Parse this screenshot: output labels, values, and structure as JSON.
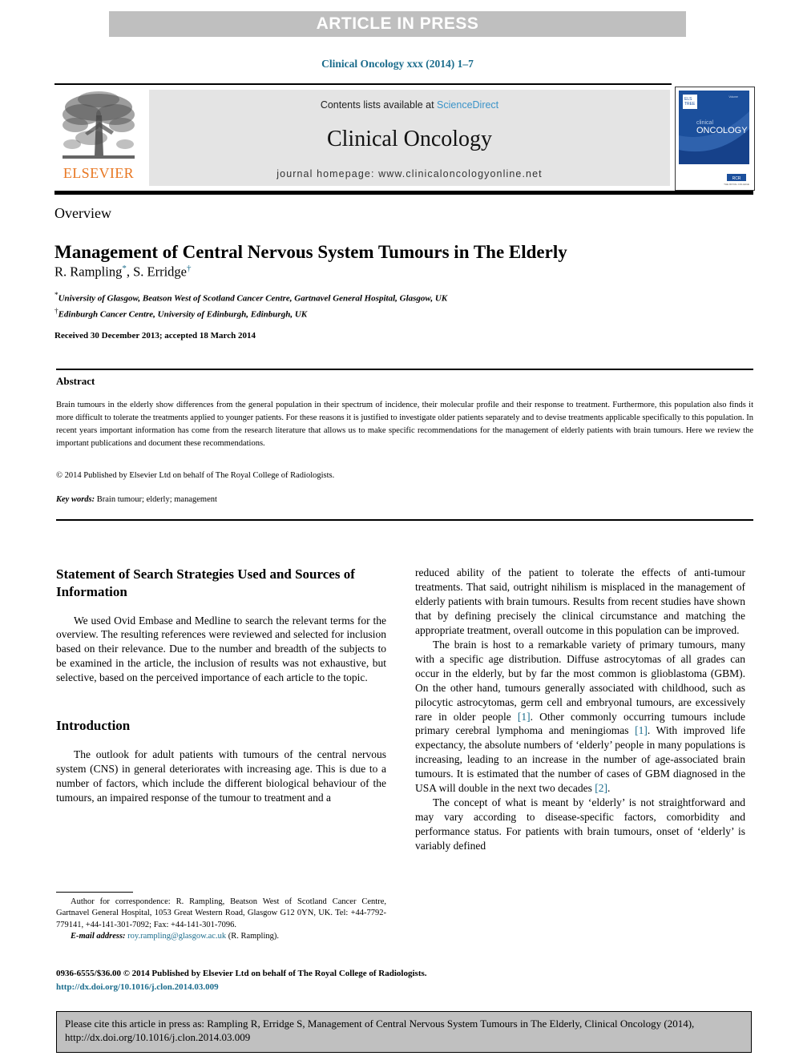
{
  "banner": {
    "label": "ARTICLE IN PRESS"
  },
  "volume": {
    "line": "Clinical Oncology xxx (2014) 1–7"
  },
  "masthead": {
    "contents_prefix": "Contents lists available at ",
    "sciencedirect": "ScienceDirect",
    "journal_name": "Clinical Oncology",
    "homepage": "journal homepage: www.clinicaloncologyonline.net",
    "publisher_logo_word": "ELSEVIER",
    "cover_title_top": "clinical",
    "cover_title_main": "ONCOLOGY"
  },
  "article": {
    "doctype": "Overview",
    "title": "Management of Central Nervous System Tumours in The Elderly",
    "authors": "R. Rampling",
    "author_mark_1": "*",
    "authors_2": ", S. Erridge",
    "author_mark_2": "†",
    "affiliation_1_mark": "*",
    "affiliation_1": "University of Glasgow, Beatson West of Scotland Cancer Centre, Gartnavel General Hospital, Glasgow, UK",
    "affiliation_2_mark": "†",
    "affiliation_2": "Edinburgh Cancer Centre, University of Edinburgh, Edinburgh, UK",
    "received": "Received 30 December 2013; accepted 18 March 2014"
  },
  "abstract": {
    "heading": "Abstract",
    "body": "Brain tumours in the elderly show differences from the general population in their spectrum of incidence, their molecular profile and their response to treatment. Furthermore, this population also finds it more difficult to tolerate the treatments applied to younger patients. For these reasons it is justified to investigate older patients separately and to devise treatments applicable specifically to this population. In recent years important information has come from the research literature that allows us to make specific recommendations for the management of elderly patients with brain tumours. Here we review the important publications and document these recommendations.",
    "copyright": "© 2014 Published by Elsevier Ltd on behalf of The Royal College of Radiologists.",
    "keywords_label": "Key words:",
    "keywords_value": " Brain tumour; elderly; management"
  },
  "left_column": {
    "heading_1": "Statement of Search Strategies Used and Sources of Information",
    "paragraph_1": "We used Ovid Embase and Medline to search the relevant terms for the overview. The resulting references were reviewed and selected for inclusion based on their relevance. Due to the number and breadth of the subjects to be examined in the article, the inclusion of results was not exhaustive, but selective, based on the perceived importance of each article to the topic.",
    "heading_2": "Introduction",
    "paragraph_2": "The outlook for adult patients with tumours of the central nervous system (CNS) in general deteriorates with increasing age. This is due to a number of factors, which include the different biological behaviour of the tumours, an impaired response of the tumour to treatment and a"
  },
  "right_column": {
    "paragraph_1": "reduced ability of the patient to tolerate the effects of anti-tumour treatments. That said, outright nihilism is misplaced in the management of elderly patients with brain tumours. Results from recent studies have shown that by defining precisely the clinical circumstance and matching the appropriate treatment, overall outcome in this population can be improved.",
    "paragraph_2a": "The brain is host to a remarkable variety of primary tumours, many with a specific age distribution. Diffuse astrocytomas of all grades can occur in the elderly, but by far the most common is glioblastoma (GBM). On the other hand, tumours generally associated with childhood, such as pilocytic astrocytomas, germ cell and embryonal tumours, are excessively rare in older people ",
    "ref_1": "[1]",
    "paragraph_2b": ". Other commonly occurring tumours include primary cerebral lymphoma and meningiomas ",
    "ref_2": "[1]",
    "paragraph_2c": ". With improved life expectancy, the absolute numbers of ‘elderly’ people in many populations is increasing, leading to an increase in the number of age-associated brain tumours. It is estimated that the number of cases of GBM diagnosed in the USA will double in the next two decades ",
    "ref_3": "[2]",
    "paragraph_2d": ".",
    "paragraph_3": "The concept of what is meant by ‘elderly’ is not straightforward and may vary according to disease-specific factors, comorbidity and performance status. For patients with brain tumours, onset of ‘elderly’ is variably defined"
  },
  "footnote": {
    "correspondence": "Author for correspondence: R. Rampling, Beatson West of Scotland Cancer Centre, Gartnavel General Hospital, 1053 Great Western Road, Glasgow G12 0YN, UK. Tel: +44-7792-779141, +44-141-301-7092; Fax: +44-141-301-7096.",
    "email_label": "E-mail address:",
    "email_value": "roy.rampling@glasgow.ac.uk",
    "email_suffix": " (R. Rampling)."
  },
  "publisher": {
    "issn_line": "0936-6555/$36.00 © 2014 Published by Elsevier Ltd on behalf of The Royal College of Radiologists.",
    "doi": "http://dx.doi.org/10.1016/j.clon.2014.03.009"
  },
  "cite_box": {
    "text": "Please cite this article in press as: Rampling R, Erridge S, Management of Central Nervous System Tumours in The Elderly, Clinical Oncology (2014), http://dx.doi.org/10.1016/j.clon.2014.03.009"
  },
  "colors": {
    "banner_bg": "#bfbfbf",
    "link_blue": "#1b6c8c",
    "sciencedirect_blue": "#3a93c8",
    "elsevier_orange": "#e87722",
    "band_gray": "#e4e4e4",
    "cite_gray": "#c0c0c0",
    "cover_blue": "#1b4f9c"
  }
}
